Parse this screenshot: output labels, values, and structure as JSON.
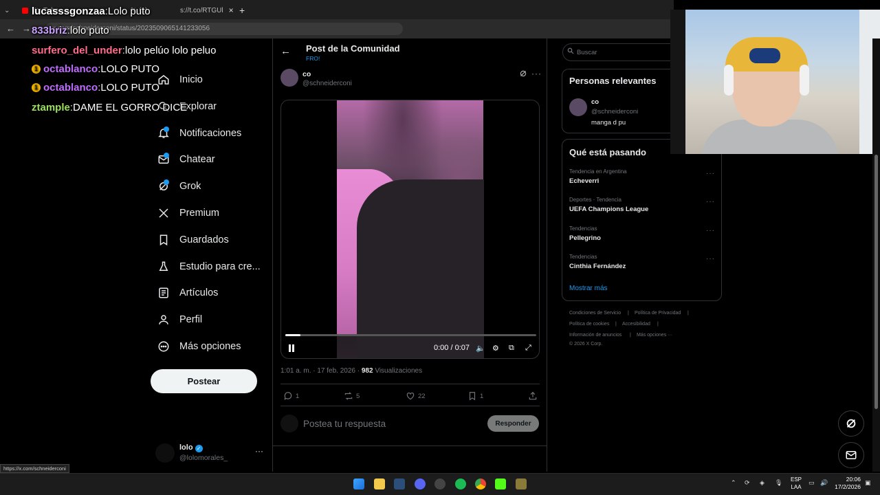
{
  "browser": {
    "tabs": [
      {
        "label": "YouTube"
      },
      {
        "label": "(1)"
      },
      {
        "label": "s://t.co/RTGUl"
      }
    ],
    "url": "x.com/schneiderconi/status/2023509065141233056",
    "status_url": "https://x.com/schneiderconi"
  },
  "chat": [
    {
      "user": "lucasssgonzaa",
      "message": "Lolo puto",
      "color": "#ffffff"
    },
    {
      "user": "833briz",
      "message": "lolo puto",
      "color": "#c9a0ff"
    },
    {
      "user": "surfero_del_under",
      "message": "lolo pelúo lolo peluo",
      "color": "#ff6b8a"
    },
    {
      "user": "octablanco",
      "message": "LOLO PUTO",
      "color": "#c06bff"
    },
    {
      "user": "octablanco",
      "message": "LOLO PUTO",
      "color": "#c06bff"
    },
    {
      "user": "ztample",
      "message": "DAME EL GORRO DICE",
      "color": "#9be25b"
    }
  ],
  "nav": {
    "items": [
      {
        "label": "Inicio",
        "icon": "home-icon"
      },
      {
        "label": "Explorar",
        "icon": "search-icon"
      },
      {
        "label": "Notificaciones",
        "icon": "bell-icon"
      },
      {
        "label": "Chatear",
        "icon": "mail-icon"
      },
      {
        "label": "Grok",
        "icon": "grok-icon"
      },
      {
        "label": "Premium",
        "icon": "x-logo-icon"
      },
      {
        "label": "Guardados",
        "icon": "bookmark-icon"
      },
      {
        "label": "Estudio para cre...",
        "icon": "flask-icon"
      },
      {
        "label": "Artículos",
        "icon": "article-icon"
      },
      {
        "label": "Perfil",
        "icon": "person-icon"
      },
      {
        "label": "Más opciones",
        "icon": "more-circle-icon"
      }
    ],
    "post_button": "Postear",
    "account": {
      "name": "lolo",
      "handle": "@lolomorales_"
    }
  },
  "main": {
    "title": "Post de la Comunidad",
    "community": "FRO!",
    "post": {
      "author_name": "co",
      "author_handle": "@schneiderconi",
      "video_time": "0:00 / 0:07",
      "video_progress": 0.06,
      "timestamp": "1:01 a. m. · 17 feb. 2026 · ",
      "views_count": "982",
      "views_label": " Visualizaciones",
      "replies": "1",
      "reposts": "5",
      "likes": "22",
      "bookmarks": "1"
    },
    "reply_placeholder": "Postea tu respuesta",
    "reply_button": "Responder"
  },
  "sidebar": {
    "search_placeholder": "Buscar",
    "relevant_title": "Personas relevantes",
    "relevant_person": {
      "name": "co",
      "handle": "@schneiderconi",
      "bio": "manga d pu"
    },
    "trending_title": "Qué está pasando",
    "trends": [
      {
        "context": "Tendencia en Argentina",
        "name": "Echeverri"
      },
      {
        "context": "Deportes · Tendencia",
        "name": "UEFA Champions League"
      },
      {
        "context": "Tendencias",
        "name": "Pellegrino"
      },
      {
        "context": "Tendencias",
        "name": "Cinthia Fernández"
      }
    ],
    "show_more": "Mostrar más",
    "footer": [
      "Condiciones de Servicio",
      "|",
      "Política de Privacidad",
      "|",
      "Política de cookies",
      "|",
      "Accesibilidad",
      "|",
      "Información de anuncios",
      "|",
      "Más opciones ···",
      "© 2026 X Corp."
    ]
  },
  "taskbar": {
    "language": "ESP",
    "layout": "LAA",
    "time": "20:06",
    "date": "17/2/2026"
  }
}
